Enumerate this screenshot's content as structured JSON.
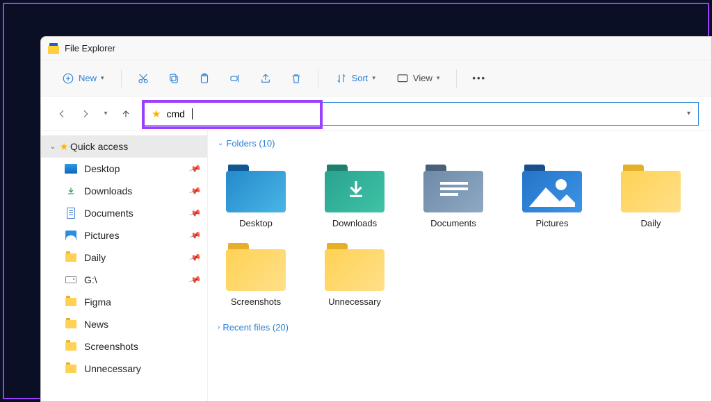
{
  "window": {
    "title": "File Explorer"
  },
  "toolbar": {
    "new": "New",
    "sort": "Sort",
    "view": "View"
  },
  "address": {
    "value": "cmd"
  },
  "sidebar": {
    "quick_access": "Quick access",
    "items": [
      {
        "label": "Desktop",
        "icon": "desktop",
        "pinned": true
      },
      {
        "label": "Downloads",
        "icon": "download",
        "pinned": true
      },
      {
        "label": "Documents",
        "icon": "doc",
        "pinned": true
      },
      {
        "label": "Pictures",
        "icon": "pic",
        "pinned": true
      },
      {
        "label": "Daily",
        "icon": "folder",
        "pinned": true
      },
      {
        "label": "G:\\",
        "icon": "drive",
        "pinned": true
      },
      {
        "label": "Figma",
        "icon": "folder",
        "pinned": false
      },
      {
        "label": "News",
        "icon": "folder",
        "pinned": false
      },
      {
        "label": "Screenshots",
        "icon": "folder",
        "pinned": false
      },
      {
        "label": "Unnecessary",
        "icon": "folder",
        "pinned": false
      }
    ]
  },
  "sections": {
    "folders": {
      "label": "Folders (10)",
      "count": 10
    },
    "recent": {
      "label": "Recent files (20)",
      "count": 20
    }
  },
  "folders": [
    {
      "name": "Desktop",
      "variant": "desktop"
    },
    {
      "name": "Downloads",
      "variant": "downloads"
    },
    {
      "name": "Documents",
      "variant": "documents"
    },
    {
      "name": "Pictures",
      "variant": "pictures"
    },
    {
      "name": "Daily",
      "variant": "yellow"
    },
    {
      "name": "Screenshots",
      "variant": "yellow"
    },
    {
      "name": "Unnecessary",
      "variant": "yellow"
    }
  ]
}
